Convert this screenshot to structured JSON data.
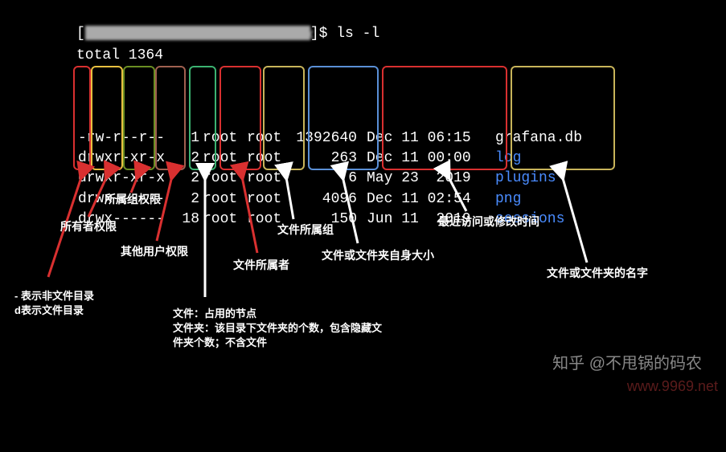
{
  "prompt": {
    "open_bracket": "[",
    "host_blurred": "xxxxx-xx-xx.xxx-xxxxxx-1 xxxx",
    "close_bracket": "]$",
    "command": "ls -l"
  },
  "total_line": "total 1364",
  "listing": [
    {
      "perm": "-rw-r--r--",
      "links": "1",
      "owner": "root",
      "group": "root",
      "size": "1392640",
      "date": "Dec 11 06:15",
      "name": "grafana.db",
      "name_color": "#fff"
    },
    {
      "perm": "drwxr-xr-x",
      "links": "2",
      "owner": "root",
      "group": "root",
      "size": "263",
      "date": "Dec 11 00:00",
      "name": "log",
      "name_color": "#4a8cff"
    },
    {
      "perm": "drwxr-xr-x",
      "links": "2",
      "owner": "root",
      "group": "root",
      "size": "6",
      "date": "May 23  2019",
      "name": "plugins",
      "name_color": "#4a8cff"
    },
    {
      "perm": "drwx------",
      "links": "2",
      "owner": "root",
      "group": "root",
      "size": "4096",
      "date": "Dec 11 02:54",
      "name": "png",
      "name_color": "#4a8cff"
    },
    {
      "perm": "drwx------",
      "links": "18",
      "owner": "root",
      "group": "root",
      "size": "150",
      "date": "Jun 11  2019",
      "name": "sessions",
      "name_color": "#4a8cff"
    }
  ],
  "annotations": {
    "type_label_1": "- 表示非文件目录",
    "type_label_2": "d表示文件目录",
    "owner_perm": "所有者权限",
    "group_perm": "所属组权限",
    "other_perm": "其他用户权限",
    "links_1": "文件：占用的节点",
    "links_2": "文件夹：该目录下文件夹的个数，包含隐藏文",
    "links_3": "件夹个数；不含文件",
    "owner": "文件所属者",
    "group": "文件所属组",
    "size": "文件或文件夹自身大小",
    "date": "最近访问或修改时间",
    "name": "文件或文件夹的名字"
  },
  "watermark1": "知乎 @不甩锅的码农",
  "watermark2": "www.9969.net"
}
